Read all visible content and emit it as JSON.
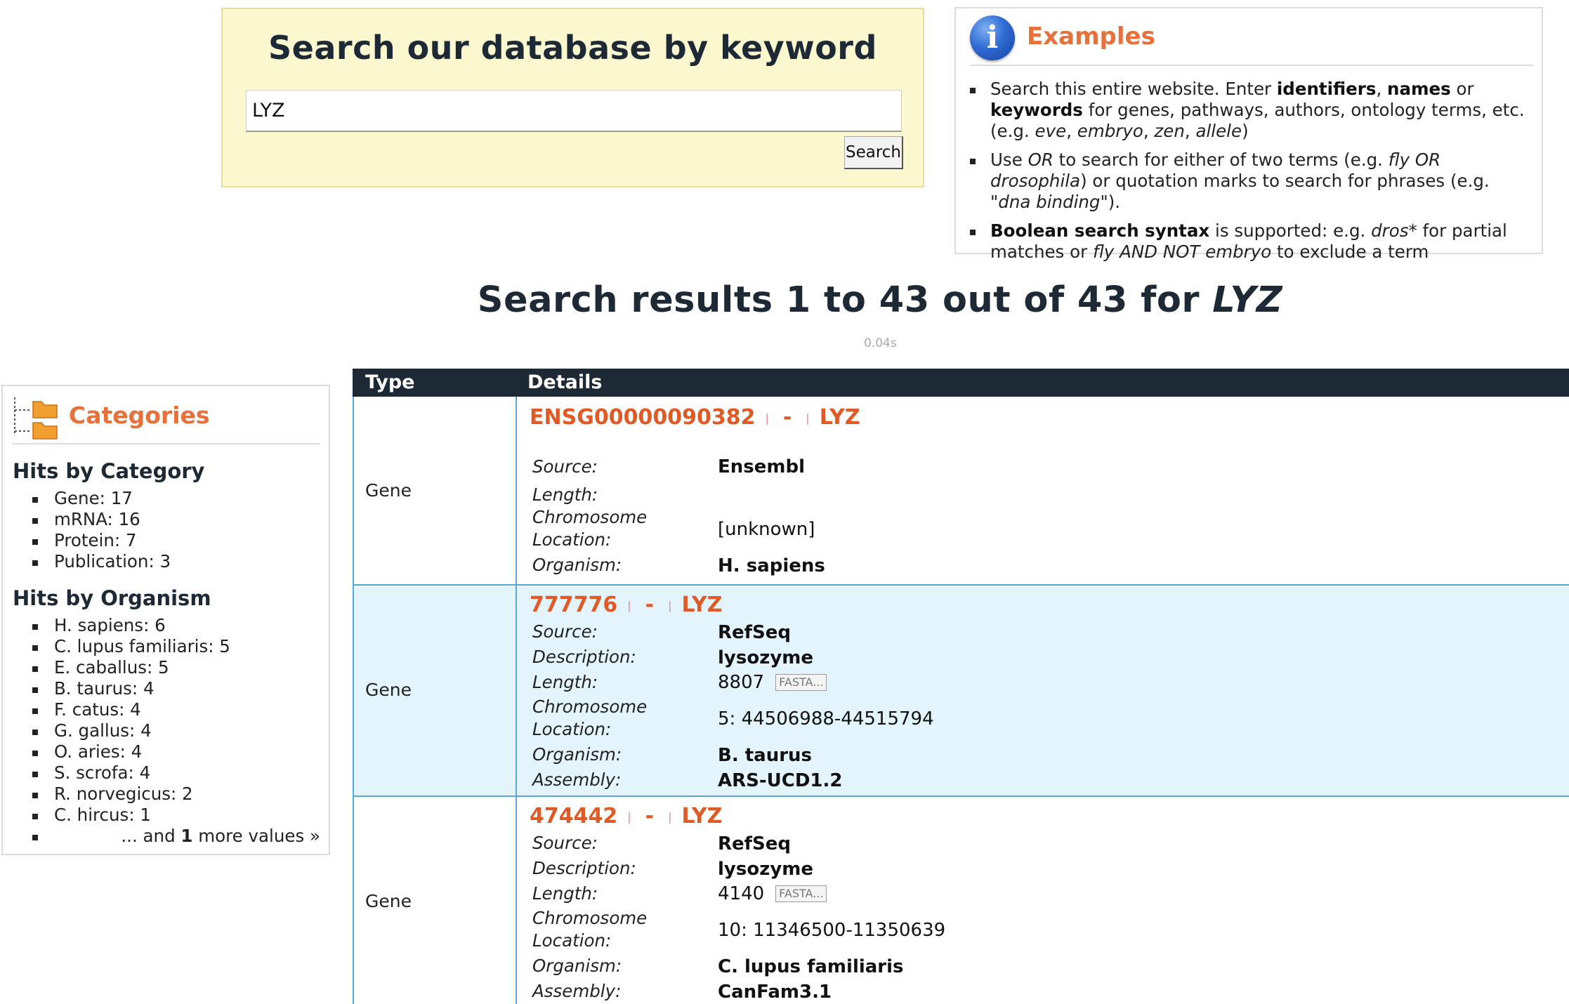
{
  "search": {
    "title": "Search our database by keyword",
    "value": "LYZ",
    "button_label": "Search"
  },
  "examples": {
    "title": "Examples",
    "items": [
      {
        "t1": "Search this entire website. Enter ",
        "b1": "identifiers",
        "t2": ", ",
        "b2": "names",
        "t3": " or ",
        "b3": "keywords",
        "t4": " for genes, pathways, authors, ontology terms, etc. (e.g. ",
        "i1": "eve",
        "t5": ", ",
        "i2": "embryo",
        "t6": ", ",
        "i3": "zen",
        "t7": ", ",
        "i4": "allele",
        "t8": ")"
      },
      {
        "t1": "Use ",
        "i1": "OR",
        "t2": " to search for either of two terms (e.g. ",
        "i2": "fly OR drosophila",
        "t3": ") or quotation marks to search for phrases (e.g. ",
        "i3": "\"dna binding\"",
        "t4": ")."
      },
      {
        "b1": "Boolean search syntax",
        "t1": " is supported: e.g. ",
        "i1": "dros*",
        "t2": " for partial matches or ",
        "i2": "fly AND NOT embryo",
        "t3": " to exclude a term"
      }
    ]
  },
  "results": {
    "heading_prefix": "Search results 1 to 43 out of 43 for ",
    "query": "LYZ",
    "timing": "0.04s"
  },
  "categories": {
    "title": "Categories",
    "by_category_heading": "Hits by Category",
    "by_category": [
      "Gene: 17",
      "mRNA: 16",
      "Protein: 7",
      "Publication: 3"
    ],
    "by_organism_heading": "Hits by Organism",
    "by_organism": [
      "H. sapiens: 6",
      "C. lupus familiaris: 5",
      "E. caballus: 5",
      "B. taurus: 4",
      "F. catus: 4",
      "G. gallus: 4",
      "O. aries: 4",
      "S. scrofa: 4",
      "R. norvegicus: 2",
      "C. hircus: 1"
    ],
    "more_prefix": "... and ",
    "more_count": "1",
    "more_suffix": " more values »"
  },
  "table": {
    "col_type": "Type",
    "col_details": "Details",
    "labels": {
      "source": "Source:",
      "description": "Description:",
      "length": "Length:",
      "chromosome_1": "Chromosome",
      "chromosome_2": "Location:",
      "organism": "Organism:",
      "assembly": "Assembly:"
    },
    "fasta_label": "FASTA...",
    "separator": "|",
    "dash": "-",
    "rows": [
      {
        "type": "Gene",
        "id": "ENSG00000090382",
        "symbol": "LYZ",
        "source": "Ensembl",
        "length": "",
        "chromosome_location": "[unknown]",
        "organism": "H. sapiens"
      },
      {
        "type": "Gene",
        "id": "777776",
        "symbol": "LYZ",
        "source": "RefSeq",
        "description": "lysozyme",
        "length": "8807",
        "chromosome_location": "5: 44506988-44515794",
        "organism": "B. taurus",
        "assembly": "ARS-UCD1.2"
      },
      {
        "type": "Gene",
        "id": "474442",
        "symbol": "LYZ",
        "source": "RefSeq",
        "description": "lysozyme",
        "length": "4140",
        "chromosome_location": "10: 11346500-11350639",
        "organism": "C. lupus familiaris",
        "assembly": "CanFam3.1"
      }
    ]
  },
  "colors": {
    "accent_orange": "#e05a26",
    "header_dark": "#1d2a35",
    "row_highlight": "#e3f4fc",
    "row_border": "#5aa7d6",
    "search_bg": "#fbf7cf"
  }
}
